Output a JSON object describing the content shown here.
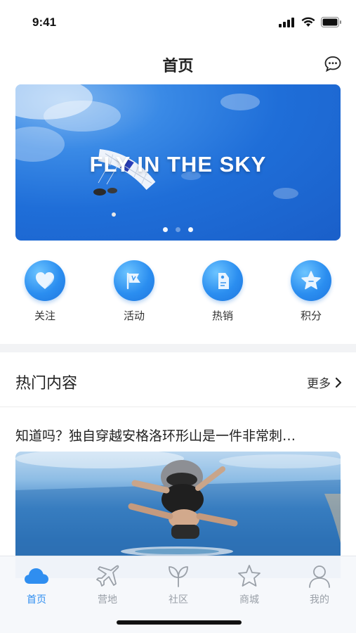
{
  "status_bar": {
    "time": "9:41"
  },
  "nav": {
    "title": "首页",
    "message_icon": "chat-bubble-icon"
  },
  "banner": {
    "headline": "FLY IN THE SKY",
    "slide_count": 3,
    "active_slide": 1
  },
  "quick_menu": [
    {
      "label": "关注",
      "icon": "heart-icon"
    },
    {
      "label": "活动",
      "icon": "flag-icon"
    },
    {
      "label": "热销",
      "icon": "tag-icon"
    },
    {
      "label": "积分",
      "icon": "star-icon"
    }
  ],
  "section": {
    "title": "热门内容",
    "more_label": "更多"
  },
  "article": {
    "title": "知道吗？独自穿越安格洛环形山是一件非常刺…"
  },
  "tab_bar": [
    {
      "label": "首页",
      "icon": "cloud-icon",
      "active": true
    },
    {
      "label": "营地",
      "icon": "airplane-icon",
      "active": false
    },
    {
      "label": "社区",
      "icon": "leaf-icon",
      "active": false
    },
    {
      "label": "商城",
      "icon": "star-outline-icon",
      "active": false
    },
    {
      "label": "我的",
      "icon": "person-icon",
      "active": false
    }
  ],
  "colors": {
    "accent": "#2f8ef0",
    "inactive": "#9aa0a8"
  }
}
